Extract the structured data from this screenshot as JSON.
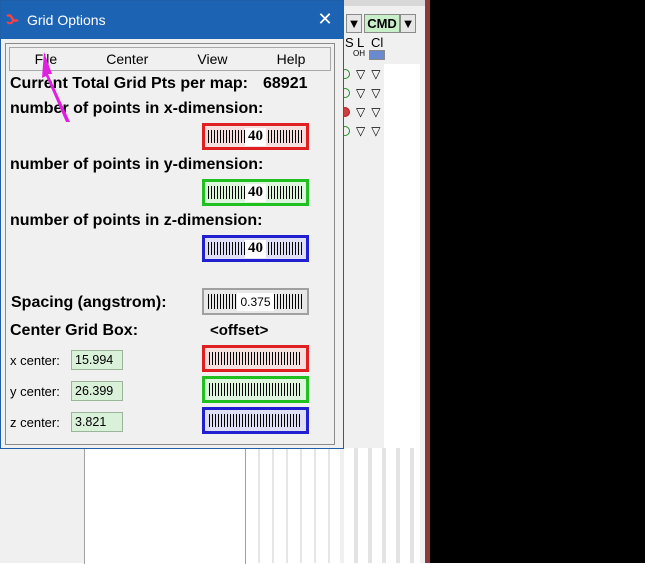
{
  "background": {
    "cmd_label": "CMD",
    "header_labels": [
      "S",
      "L",
      "Cl"
    ],
    "sub_labels": [
      "OH"
    ],
    "dropdown_glyph": "▼",
    "row_glyph": "▽"
  },
  "dialog": {
    "title": "Grid Options",
    "title_icon": "app-logo-icon",
    "close_glyph": "✕",
    "menu": [
      "File",
      "Center",
      "View",
      "Help"
    ],
    "total_grid_label": "Current Total Grid Pts per map:",
    "total_grid_value": "68921",
    "x_points_label": "number of points in x-dimension:",
    "x_points_value": "40",
    "y_points_label": "number of points in y-dimension:",
    "y_points_value": "40",
    "z_points_label": "number of points in z-dimension:",
    "z_points_value": "40",
    "spacing_label": "Spacing (angstrom):",
    "spacing_value": "0.375",
    "center_label": "Center Grid Box:",
    "offset_label": "<offset>",
    "x_center_label": "x center:",
    "x_center_value": "15.994",
    "y_center_label": "y center:",
    "y_center_value": "26.399",
    "z_center_label": "z center:",
    "z_center_value": "3.821"
  },
  "colors": {
    "titlebar": "#1c63b4",
    "x_axis": "#e02020",
    "y_axis": "#20c020",
    "z_axis": "#2020d0",
    "value_field": "#d9f0d9",
    "cursor": "#e020e0"
  }
}
